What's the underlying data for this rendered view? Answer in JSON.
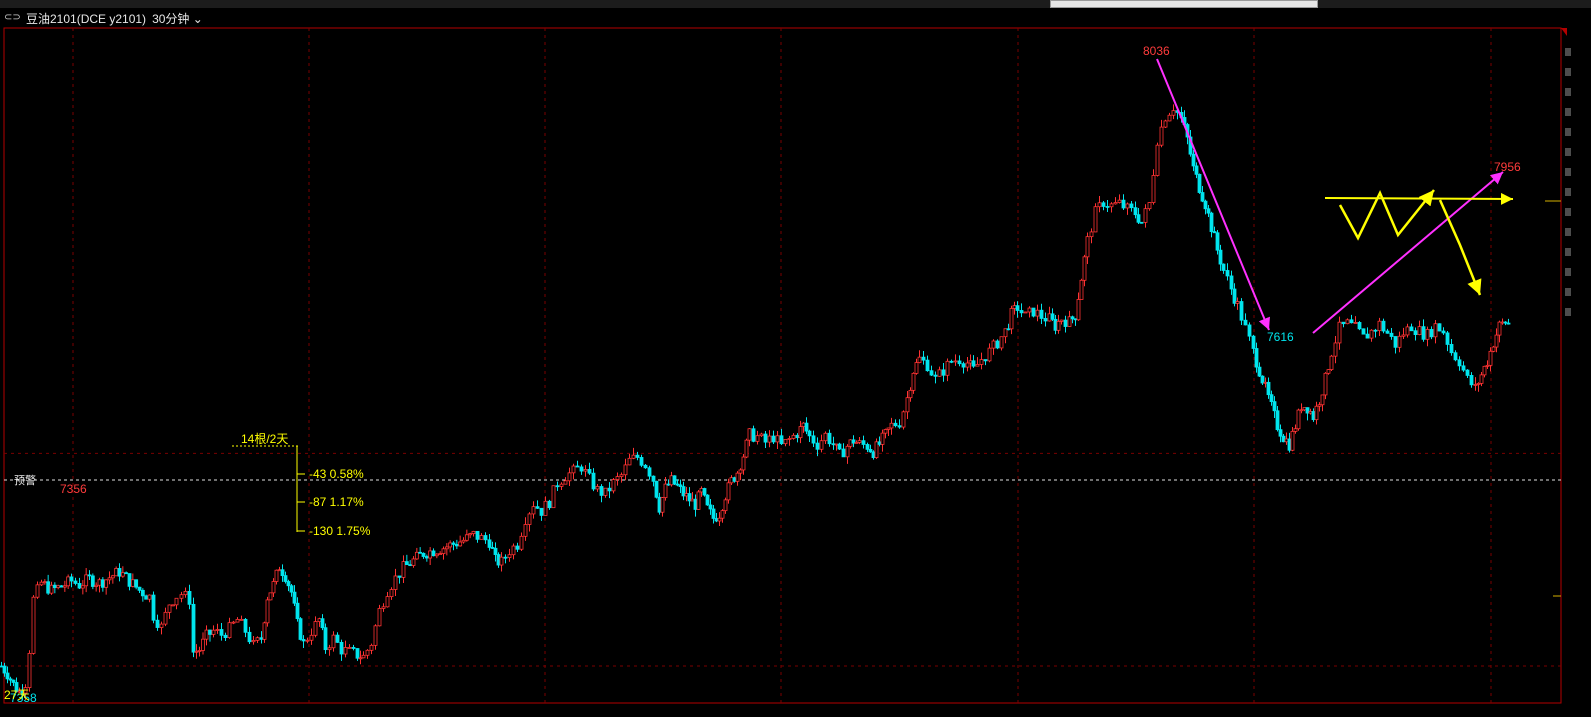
{
  "header": {
    "link_icon": "link-icon",
    "symbol": "豆油2101(DCE y2101)",
    "period": "30分钟",
    "dropdown_icon": "chevron-down-icon"
  },
  "alert_label": "预警",
  "colors": {
    "up": "#ff3232",
    "down": "#00e5ee",
    "frame": "#b40000",
    "grid": "#7a0000",
    "magenta": "#ff30ff",
    "yellow": "#ffff00",
    "text_red": "#ff3c3c",
    "text_cyan": "#00e5ee"
  },
  "chart_data": {
    "type": "candlestick",
    "price_labels": [
      {
        "text": "8036",
        "kind": "high"
      },
      {
        "text": "7356",
        "kind": "high"
      },
      {
        "text": "7616",
        "kind": "low"
      },
      {
        "text": "7956",
        "kind": "high"
      },
      {
        "text": "7358",
        "kind": "low"
      },
      {
        "text": "27天",
        "kind": "note"
      }
    ],
    "measure_tool": {
      "title": "14根/2天",
      "levels": [
        {
          "points": "-43",
          "pct": "0.58%"
        },
        {
          "points": "-87",
          "pct": "1.17%"
        },
        {
          "points": "-130",
          "pct": "1.75%"
        }
      ]
    },
    "price_range": [
      7340,
      8070
    ],
    "close_path": [
      [
        0,
        7380
      ],
      [
        6,
        7372
      ],
      [
        12,
        7360
      ],
      [
        18,
        7352
      ],
      [
        24,
        7362
      ],
      [
        28,
        7398
      ],
      [
        32,
        7452
      ],
      [
        40,
        7470
      ],
      [
        50,
        7462
      ],
      [
        60,
        7466
      ],
      [
        70,
        7472
      ],
      [
        78,
        7468
      ],
      [
        88,
        7474
      ],
      [
        98,
        7470
      ],
      [
        108,
        7476
      ],
      [
        118,
        7482
      ],
      [
        128,
        7472
      ],
      [
        138,
        7462
      ],
      [
        148,
        7455
      ],
      [
        152,
        7435
      ],
      [
        160,
        7422
      ],
      [
        168,
        7448
      ],
      [
        175,
        7456
      ],
      [
        180,
        7458
      ],
      [
        188,
        7452
      ],
      [
        192,
        7395
      ],
      [
        198,
        7398
      ],
      [
        205,
        7412
      ],
      [
        212,
        7418
      ],
      [
        220,
        7414
      ],
      [
        228,
        7420
      ],
      [
        236,
        7430
      ],
      [
        244,
        7418
      ],
      [
        252,
        7402
      ],
      [
        260,
        7410
      ],
      [
        266,
        7455
      ],
      [
        272,
        7468
      ],
      [
        278,
        7488
      ],
      [
        284,
        7478
      ],
      [
        290,
        7460
      ],
      [
        296,
        7425
      ],
      [
        302,
        7404
      ],
      [
        310,
        7418
      ],
      [
        318,
        7430
      ],
      [
        324,
        7400
      ],
      [
        332,
        7410
      ],
      [
        340,
        7398
      ],
      [
        348,
        7395
      ],
      [
        356,
        7392
      ],
      [
        362,
        7390
      ],
      [
        370,
        7405
      ],
      [
        378,
        7440
      ],
      [
        386,
        7462
      ],
      [
        394,
        7475
      ],
      [
        402,
        7486
      ],
      [
        412,
        7494
      ],
      [
        422,
        7502
      ],
      [
        432,
        7505
      ],
      [
        442,
        7508
      ],
      [
        452,
        7512
      ],
      [
        462,
        7516
      ],
      [
        472,
        7522
      ],
      [
        480,
        7518
      ],
      [
        488,
        7515
      ],
      [
        494,
        7494
      ],
      [
        500,
        7492
      ],
      [
        508,
        7505
      ],
      [
        516,
        7512
      ],
      [
        524,
        7540
      ],
      [
        532,
        7556
      ],
      [
        540,
        7548
      ],
      [
        548,
        7558
      ],
      [
        556,
        7578
      ],
      [
        564,
        7586
      ],
      [
        572,
        7590
      ],
      [
        580,
        7596
      ],
      [
        588,
        7582
      ],
      [
        596,
        7570
      ],
      [
        604,
        7566
      ],
      [
        612,
        7578
      ],
      [
        620,
        7586
      ],
      [
        628,
        7602
      ],
      [
        636,
        7606
      ],
      [
        644,
        7598
      ],
      [
        652,
        7582
      ],
      [
        658,
        7552
      ],
      [
        664,
        7572
      ],
      [
        670,
        7580
      ],
      [
        676,
        7574
      ],
      [
        682,
        7566
      ],
      [
        688,
        7560
      ],
      [
        694,
        7555
      ],
      [
        700,
        7568
      ],
      [
        706,
        7550
      ],
      [
        712,
        7540
      ],
      [
        718,
        7545
      ],
      [
        724,
        7565
      ],
      [
        730,
        7580
      ],
      [
        736,
        7590
      ],
      [
        742,
        7608
      ],
      [
        748,
        7630
      ],
      [
        756,
        7628
      ],
      [
        764,
        7622
      ],
      [
        772,
        7628
      ],
      [
        780,
        7618
      ],
      [
        788,
        7625
      ],
      [
        796,
        7632
      ],
      [
        802,
        7640
      ],
      [
        808,
        7628
      ],
      [
        816,
        7620
      ],
      [
        824,
        7630
      ],
      [
        832,
        7620
      ],
      [
        838,
        7608
      ],
      [
        846,
        7618
      ],
      [
        852,
        7624
      ],
      [
        858,
        7620
      ],
      [
        866,
        7618
      ],
      [
        872,
        7612
      ],
      [
        878,
        7620
      ],
      [
        884,
        7630
      ],
      [
        890,
        7640
      ],
      [
        898,
        7644
      ],
      [
        906,
        7670
      ],
      [
        912,
        7700
      ],
      [
        918,
        7712
      ],
      [
        926,
        7706
      ],
      [
        934,
        7690
      ],
      [
        942,
        7700
      ],
      [
        950,
        7710
      ],
      [
        958,
        7712
      ],
      [
        966,
        7708
      ],
      [
        972,
        7700
      ],
      [
        980,
        7712
      ],
      [
        988,
        7720
      ],
      [
        996,
        7730
      ],
      [
        1004,
        7742
      ],
      [
        1010,
        7760
      ],
      [
        1016,
        7768
      ],
      [
        1024,
        7758
      ],
      [
        1032,
        7764
      ],
      [
        1040,
        7758
      ],
      [
        1048,
        7755
      ],
      [
        1054,
        7748
      ],
      [
        1060,
        7756
      ],
      [
        1068,
        7752
      ],
      [
        1074,
        7760
      ],
      [
        1080,
        7800
      ],
      [
        1086,
        7840
      ],
      [
        1094,
        7870
      ],
      [
        1102,
        7882
      ],
      [
        1110,
        7878
      ],
      [
        1118,
        7880
      ],
      [
        1126,
        7874
      ],
      [
        1134,
        7870
      ],
      [
        1140,
        7860
      ],
      [
        1148,
        7880
      ],
      [
        1156,
        7950
      ],
      [
        1164,
        7975
      ],
      [
        1172,
        7985
      ],
      [
        1180,
        7972
      ],
      [
        1186,
        7950
      ],
      [
        1192,
        7918
      ],
      [
        1198,
        7898
      ],
      [
        1204,
        7880
      ],
      [
        1210,
        7855
      ],
      [
        1216,
        7830
      ],
      [
        1222,
        7808
      ],
      [
        1230,
        7788
      ],
      [
        1236,
        7770
      ],
      [
        1244,
        7745
      ],
      [
        1252,
        7720
      ],
      [
        1258,
        7700
      ],
      [
        1264,
        7680
      ],
      [
        1270,
        7660
      ],
      [
        1276,
        7640
      ],
      [
        1282,
        7628
      ],
      [
        1288,
        7620
      ],
      [
        1294,
        7640
      ],
      [
        1300,
        7662
      ],
      [
        1306,
        7660
      ],
      [
        1312,
        7650
      ],
      [
        1318,
        7668
      ],
      [
        1324,
        7690
      ],
      [
        1330,
        7720
      ],
      [
        1338,
        7745
      ],
      [
        1346,
        7750
      ],
      [
        1354,
        7745
      ],
      [
        1362,
        7735
      ],
      [
        1370,
        7742
      ],
      [
        1378,
        7750
      ],
      [
        1386,
        7740
      ],
      [
        1394,
        7728
      ],
      [
        1402,
        7740
      ],
      [
        1410,
        7748
      ],
      [
        1418,
        7742
      ],
      [
        1426,
        7738
      ],
      [
        1434,
        7748
      ],
      [
        1442,
        7742
      ],
      [
        1450,
        7720
      ],
      [
        1458,
        7710
      ],
      [
        1466,
        7690
      ],
      [
        1474,
        7680
      ],
      [
        1480,
        7695
      ],
      [
        1486,
        7710
      ],
      [
        1492,
        7730
      ],
      [
        1498,
        7748
      ],
      [
        1504,
        7752
      ],
      [
        1510,
        7748
      ]
    ]
  }
}
